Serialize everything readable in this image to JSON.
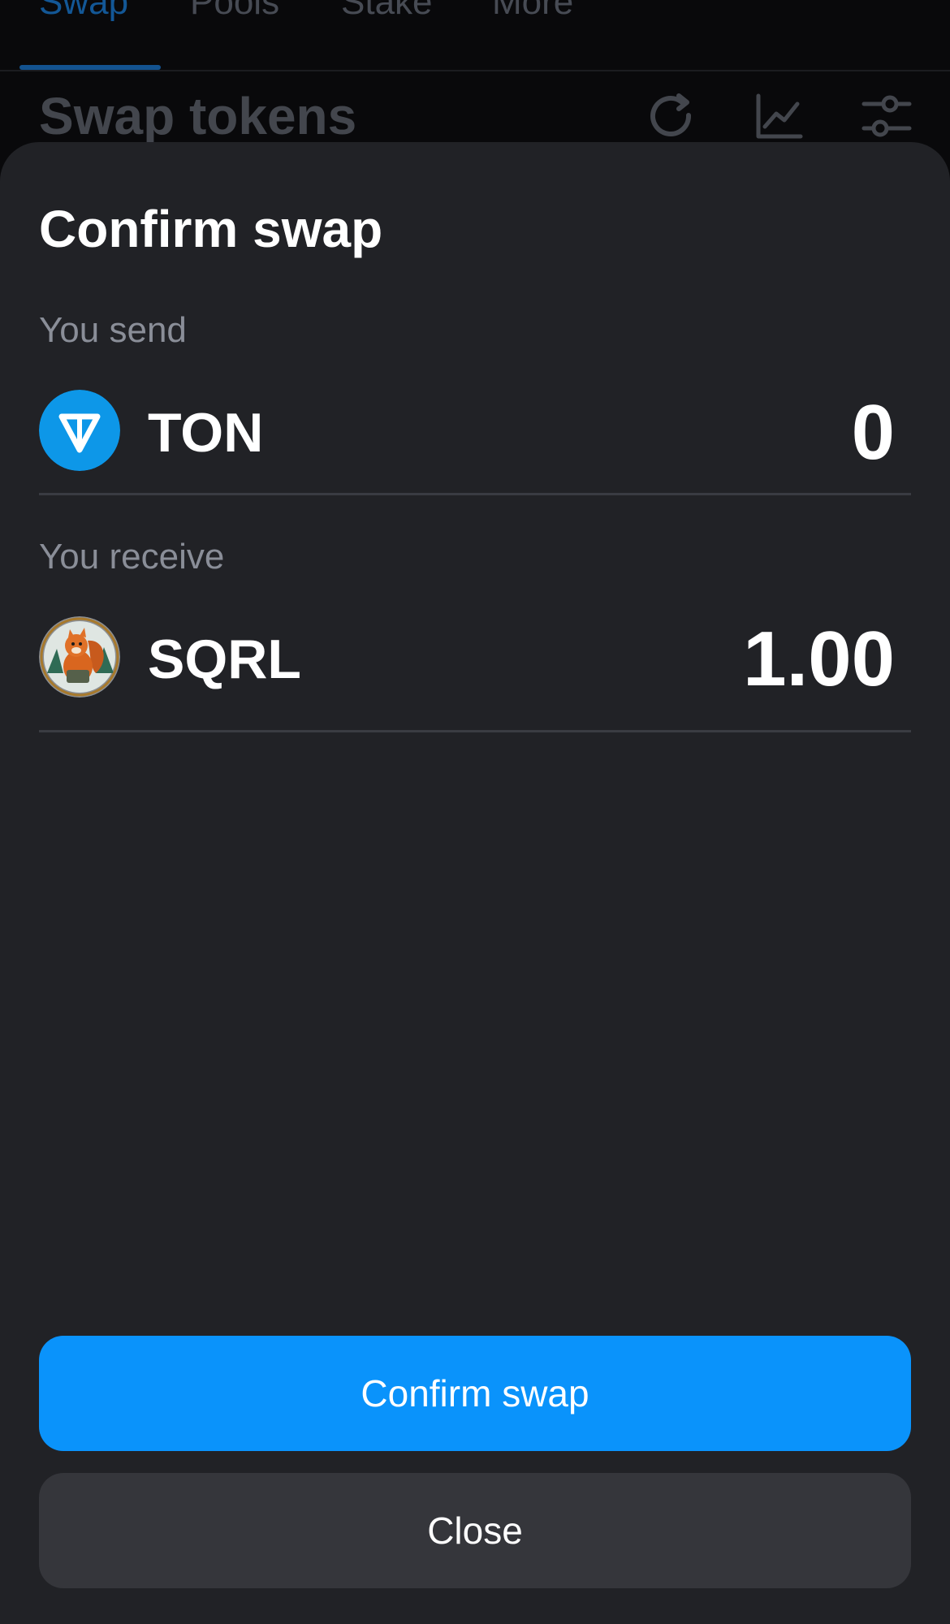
{
  "nav": {
    "tabs": [
      {
        "label": "Swap",
        "active": true
      },
      {
        "label": "Pools",
        "active": false
      },
      {
        "label": "Stake",
        "active": false
      },
      {
        "label": "More",
        "active": false
      }
    ]
  },
  "page": {
    "title": "Swap tokens",
    "icons": [
      "refresh-icon",
      "chart-icon",
      "settings-sliders-icon"
    ]
  },
  "sheet": {
    "title": "Confirm swap",
    "send": {
      "label": "You send",
      "symbol": "TON",
      "amount": "0",
      "logo": "ton-logo"
    },
    "receive": {
      "label": "You receive",
      "symbol": "SQRL",
      "amount": "1.00",
      "logo": "sqrl-squirrel-logo"
    },
    "confirm_label": "Confirm swap",
    "close_label": "Close"
  },
  "colors": {
    "accent": "#0a93fb",
    "sheet_bg": "#212226",
    "ton_blue": "#0d97e8"
  }
}
